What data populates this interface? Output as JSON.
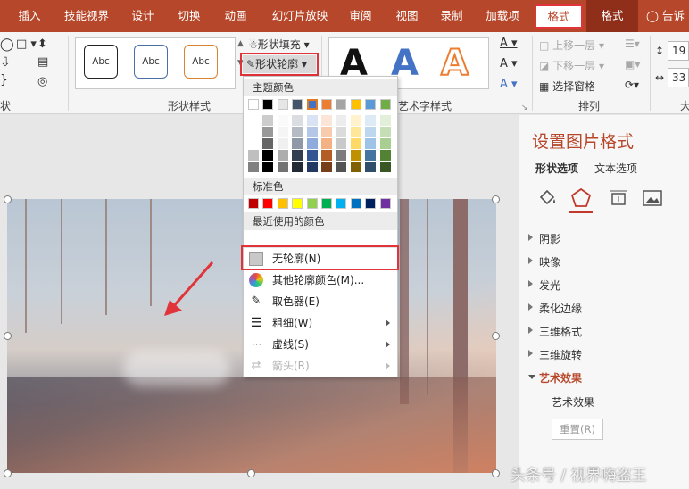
{
  "tabs": {
    "insert": "插入",
    "skill": "技能视界",
    "design": "设计",
    "transitions": "切换",
    "animations": "动画",
    "slideshow": "幻灯片放映",
    "review": "审阅",
    "view": "视图",
    "record": "录制",
    "addins": "加载项",
    "format_drawing": "格式",
    "format_picture": "格式",
    "tellme": "告诉我"
  },
  "ribbon": {
    "group_shape_tail": "状",
    "group_shape_styles": "形状样式",
    "shape_sample": "Abc",
    "shape_fill": "形状填充",
    "shape_outline": "形状轮廓",
    "wordart_letter": "A",
    "group_wordart": "艺术字样式",
    "bring_forward": "上移一层",
    "send_backward": "下移一层",
    "selection_pane": "选择窗格",
    "group_arrange": "排列",
    "group_size_tail": "大",
    "size_h": "19",
    "size_w": "33"
  },
  "dropdown": {
    "theme_colors": "主题颜色",
    "standard_colors": "标准色",
    "recent_colors": "最近使用的颜色",
    "no_outline": "无轮廓(N)",
    "more_colors": "其他轮廓颜色(M)...",
    "eyedropper": "取色器(E)",
    "weight": "粗细(W)",
    "dashes": "虚线(S)",
    "arrows": "箭头(R)"
  },
  "theme_colors_top": [
    "#ffffff",
    "#000000",
    "#e7e6e6",
    "#44546a",
    "#4472c4",
    "#ed7d31",
    "#a5a5a5",
    "#ffc000",
    "#5b9bd5",
    "#70ad47"
  ],
  "standard_color_list": [
    "#c00000",
    "#ff0000",
    "#ffc000",
    "#ffff00",
    "#92d050",
    "#00b050",
    "#00b0f0",
    "#0070c0",
    "#002060",
    "#7030a0"
  ],
  "panel": {
    "title": "设置图片格式",
    "tab_shape": "形状选项",
    "tab_text": "文本选项",
    "shadow": "阴影",
    "reflection": "映像",
    "glow": "发光",
    "soft_edges": "柔化边缘",
    "format3d": "三维格式",
    "rotation3d": "三维旋转",
    "artistic": "艺术效果",
    "artistic_sub": "艺术效果",
    "reset": "重置(R)"
  },
  "watermark": "头条号 / 视界嗨盗王",
  "accent": "#b7472a"
}
